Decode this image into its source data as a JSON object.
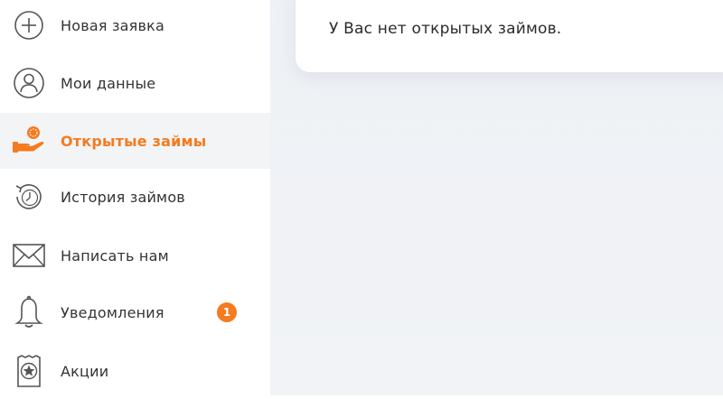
{
  "sidebar": {
    "items": [
      {
        "label": "Новая заявка",
        "icon": "plus-circle-icon"
      },
      {
        "label": "Мои данные",
        "icon": "user-icon"
      },
      {
        "label": "Открытые займы",
        "icon": "coin-hand-icon",
        "active": true
      },
      {
        "label": "История займов",
        "icon": "clock-history-icon"
      },
      {
        "label": "Написать нам",
        "icon": "envelope-icon"
      },
      {
        "label": "Уведомления",
        "icon": "bell-icon",
        "badge": "1"
      },
      {
        "label": "Акции",
        "icon": "star-ticket-icon"
      }
    ]
  },
  "main": {
    "message": "У Вас нет открытых займов."
  },
  "colors": {
    "accent": "#f47b20",
    "text": "#333333",
    "active_bg": "#f2f4f6",
    "content_bg": "#eef1f5"
  }
}
